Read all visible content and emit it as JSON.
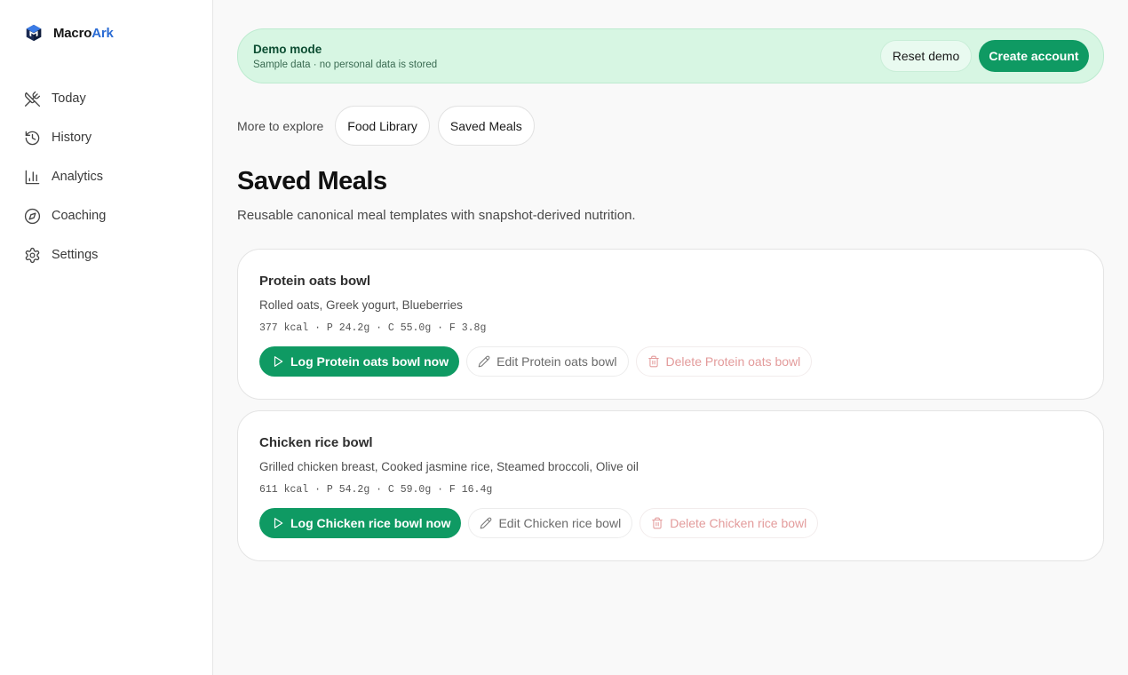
{
  "brand": {
    "name_main": "Macro",
    "name_accent": "Ark",
    "accent_color": "#2b6cd4"
  },
  "sidebar": {
    "items": [
      {
        "label": "Today",
        "icon": "utensils-crossed-icon"
      },
      {
        "label": "History",
        "icon": "history-icon"
      },
      {
        "label": "Analytics",
        "icon": "bar-chart-icon"
      },
      {
        "label": "Coaching",
        "icon": "compass-icon"
      },
      {
        "label": "Settings",
        "icon": "gear-icon"
      }
    ]
  },
  "banner": {
    "title": "Demo mode",
    "subtitle": "Sample data · no personal data is stored",
    "reset_label": "Reset demo",
    "create_label": "Create account"
  },
  "explore": {
    "label": "More to explore",
    "links": [
      "Food Library",
      "Saved Meals"
    ]
  },
  "page": {
    "title": "Saved Meals",
    "subtitle": "Reusable canonical meal templates with snapshot-derived nutrition."
  },
  "meals": [
    {
      "name": "Protein oats bowl",
      "ingredients": "Rolled oats, Greek yogurt, Blueberries",
      "macros": "377 kcal · P 24.2g · C 55.0g · F 3.8g",
      "log_label": "Log Protein oats bowl now",
      "edit_label": "Edit Protein oats bowl",
      "delete_label": "Delete Protein oats bowl"
    },
    {
      "name": "Chicken rice bowl",
      "ingredients": "Grilled chicken breast, Cooked jasmine rice, Steamed broccoli, Olive oil",
      "macros": "611 kcal · P 54.2g · C 59.0g · F 16.4g",
      "log_label": "Log Chicken rice bowl now",
      "edit_label": "Edit Chicken rice bowl",
      "delete_label": "Delete Chicken rice bowl"
    }
  ],
  "colors": {
    "primary_green": "#0f9a63",
    "banner_bg": "#d7f6e3",
    "danger_text": "#e39b9b"
  }
}
